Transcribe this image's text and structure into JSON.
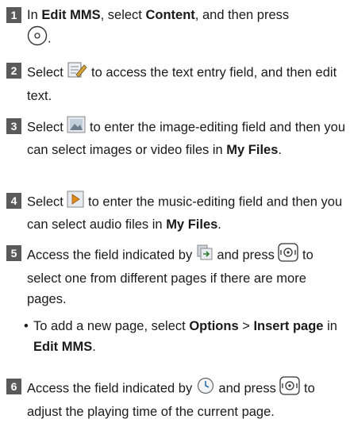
{
  "steps": [
    {
      "num": "1",
      "a": "In ",
      "b1": "Edit MMS",
      "c": ", select ",
      "b2": "Content",
      "d": ", and then press",
      "e": "."
    },
    {
      "num": "2",
      "a": "Select",
      "b": "to access the text entry field, and then edit text."
    },
    {
      "num": "3",
      "a": "Select",
      "b": "to enter the image-editing field and then you can select images or video files in ",
      "bold": "My Files",
      "c": "."
    },
    {
      "num": "4",
      "a": "Select",
      "b": "to enter the music-editing field and then you can select audio files in ",
      "bold": "My Files",
      "c": "."
    },
    {
      "num": "5",
      "a": "Access the field indicated by",
      "b": "and press",
      "c": "to select one from different pages if there are more pages."
    },
    {
      "num": "6",
      "a": "Access the field indicated by",
      "b": "and press",
      "c": "to adjust the playing time of the current page."
    }
  ],
  "sub_bullet": {
    "bullet": "•",
    "a": "To add a new page, select ",
    "b1": "Options",
    "gt": " > ",
    "b2": "Insert page",
    "c": " in ",
    "b3": "Edit MMS",
    "d": "."
  },
  "icons": [
    "select-key-icon",
    "text-edit-icon",
    "image-icon",
    "music-icon",
    "pages-icon",
    "clock-icon",
    "nav-key-icon"
  ]
}
